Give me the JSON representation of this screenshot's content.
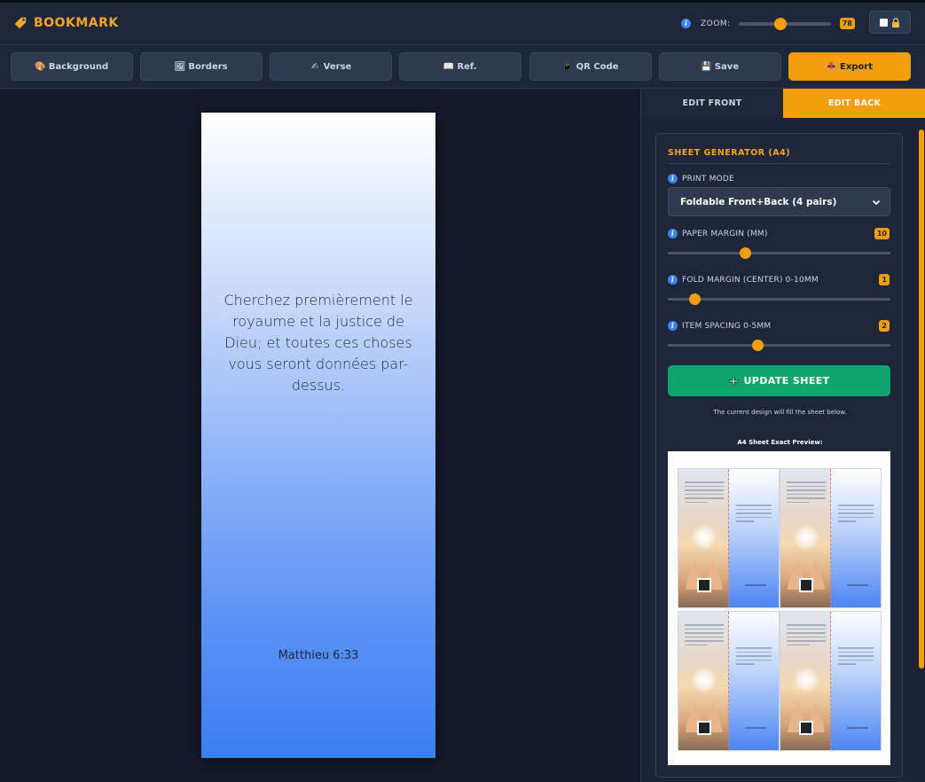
{
  "app": {
    "title": "BOOKMARK",
    "brand_color": "#f5a524"
  },
  "header": {
    "zoom_label": "ZOOM:",
    "zoom_value": "78",
    "zoom_fraction": 0.45,
    "info_icon": "info-icon",
    "lock_icon": "lock-icon"
  },
  "toolbar": {
    "items": [
      {
        "label": "Background",
        "icon": "palette-icon",
        "glyph": "🎨"
      },
      {
        "label": "Borders",
        "icon": "picture-frame-icon",
        "glyph": "🖼"
      },
      {
        "label": "Verse",
        "icon": "writing-hand-icon",
        "glyph": "✍"
      },
      {
        "label": "Ref.",
        "icon": "book-icon",
        "glyph": "📖"
      },
      {
        "label": "QR Code",
        "icon": "mobile-phone-icon",
        "glyph": "📱"
      },
      {
        "label": "Save",
        "icon": "floppy-disk-icon",
        "glyph": "💾"
      },
      {
        "label": "Export",
        "icon": "outbox-tray-icon",
        "glyph": "📤"
      }
    ]
  },
  "bookmark": {
    "verse": "Cherchez premièrement le royaume et la justice de Dieu; et toutes ces choses vous seront données par-dessus.",
    "reference": "Matthieu 6:33",
    "gradient_top": "#ffffff",
    "gradient_bottom": "#3b7ef3"
  },
  "panel": {
    "tabs": [
      {
        "label": "EDIT FRONT",
        "active": false
      },
      {
        "label": "EDIT BACK",
        "active": true
      }
    ],
    "sheet_generator": {
      "title": "SHEET GENERATOR (A4)",
      "print_mode": {
        "label": "PRINT MODE",
        "value": "Foldable Front+Back (4 pairs)"
      },
      "paper_margin": {
        "label": "PAPER MARGIN (MM)",
        "value": "10",
        "fraction": 0.34
      },
      "fold_margin": {
        "label": "FOLD MARGIN (CENTER) 0-10MM",
        "value": "1",
        "fraction": 0.1
      },
      "item_spacing": {
        "label": "ITEM SPACING 0-5MM",
        "value": "2",
        "fraction": 0.4
      },
      "update_label": "UPDATE SHEET",
      "hint": "The current design will fill the sheet below.",
      "preview_label": "A4 Sheet Exact Preview:",
      "pairs": 4
    }
  },
  "colors": {
    "accent": "#f59e0b",
    "success": "#10a56f",
    "panel_bg": "#1e273a",
    "canvas_bg": "#151b2b"
  }
}
